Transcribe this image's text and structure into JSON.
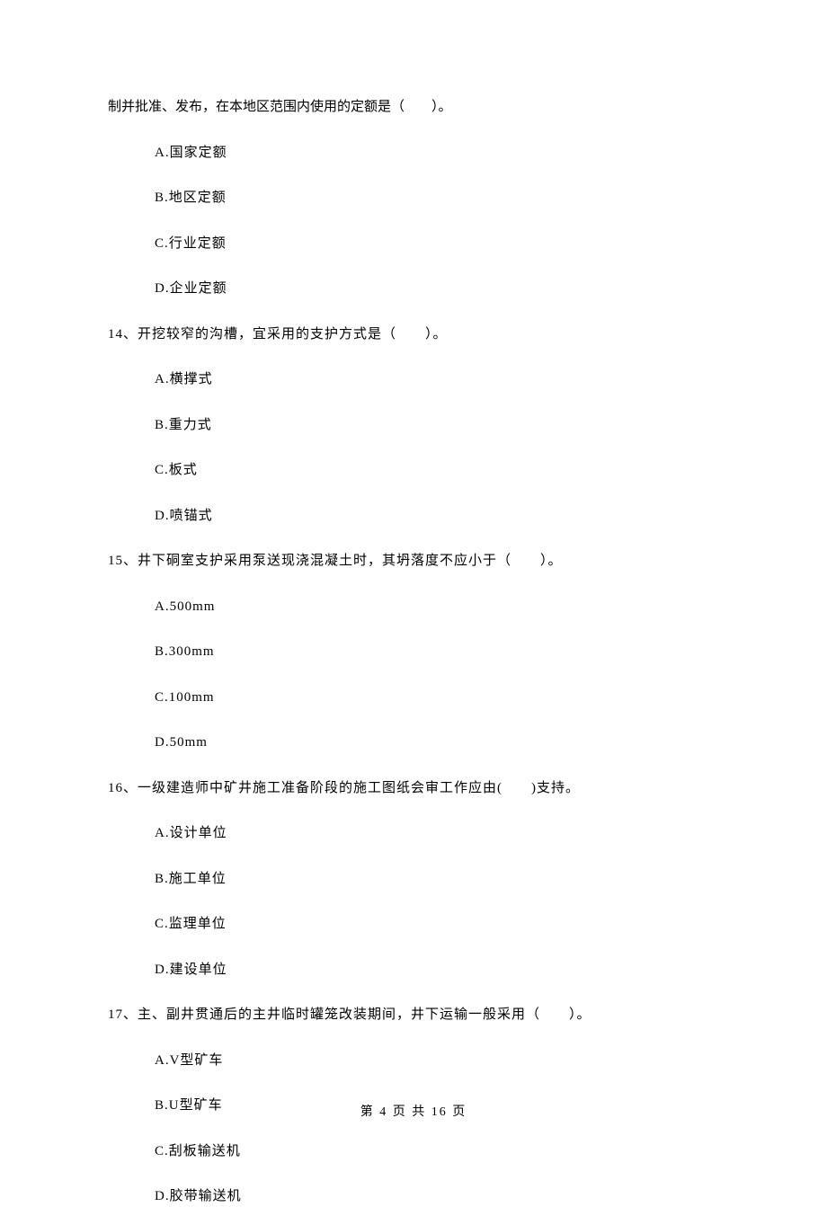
{
  "q13_continuation": "制并批准、发布，在本地区范围内使用的定额是（　　）。",
  "q13": {
    "a": "A.国家定额",
    "b": "B.地区定额",
    "c": "C.行业定额",
    "d": "D.企业定额"
  },
  "q14": {
    "text": "14、开挖较窄的沟槽，宜采用的支护方式是（　　）。",
    "a": "A.横撑式",
    "b": "B.重力式",
    "c": "C.板式",
    "d": "D.喷锚式"
  },
  "q15": {
    "text": "15、井下硐室支护采用泵送现浇混凝土时，其坍落度不应小于（　　）。",
    "a": "A.500mm",
    "b": "B.300mm",
    "c": "C.100mm",
    "d": "D.50mm"
  },
  "q16": {
    "text": "16、一级建造师中矿井施工准备阶段的施工图纸会审工作应由(　　)支持。",
    "a": "A.设计单位",
    "b": "B.施工单位",
    "c": "C.监理单位",
    "d": "D.建设单位"
  },
  "q17": {
    "text": "17、主、副井贯通后的主井临时罐笼改装期间，井下运输一般采用（　　）。",
    "a": "A.V型矿车",
    "b": "B.U型矿车",
    "c": "C.刮板输送机",
    "d": "D.胶带输送机"
  },
  "footer": "第 4 页 共 16 页"
}
